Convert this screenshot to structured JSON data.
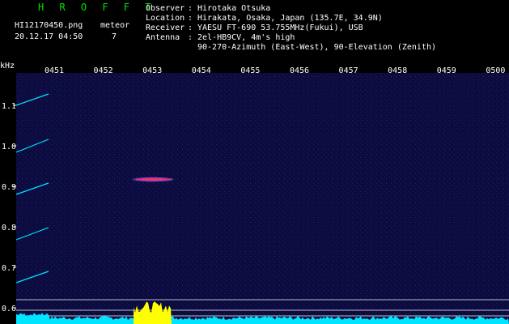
{
  "header": {
    "app_title": "H R O F F T",
    "filename": "HI12170450.png",
    "datetime": "20.12.17 04:50",
    "meteor_label": "meteor",
    "meteor_count": "7",
    "fields": [
      {
        "label": "Observer",
        "value": "Hirotaka Otsuka"
      },
      {
        "label": "Location",
        "value": "Hirakata, Osaka, Japan (135.7E, 34.9N)"
      },
      {
        "label": "Receiver",
        "value": "YAESU FT-690 53.755MHz(Fukui), USB"
      },
      {
        "label": "Antenna ",
        "value": "2el-HB9CV, 4m's high"
      },
      {
        "label": "",
        "value": "90-270-Azimuth (East-West), 90-Elevation (Zenith)"
      }
    ]
  },
  "colors": {
    "background": "#000000",
    "spectrum_bg": "#0a0a3a",
    "title_green": "#00e000",
    "trace_cyan": "#00e5ff",
    "burst_yellow": "#ffff00",
    "echo_red": "#ff3040"
  },
  "chart_data": {
    "type": "heatmap",
    "ylabel": "kHz",
    "y_ticks": [
      "1.1",
      "1.0",
      "0.9",
      "0.8",
      "0.7",
      "0.6"
    ],
    "x_ticks": [
      "0451",
      "0452",
      "0453",
      "0454",
      "0455",
      "0456",
      "0457",
      "0458",
      "0459",
      "0500"
    ],
    "echoes": [
      {
        "time": "04:52:40",
        "freq_khz": 0.917,
        "label": "meteor echo"
      }
    ],
    "ylim": [
      0.58,
      1.16
    ]
  }
}
